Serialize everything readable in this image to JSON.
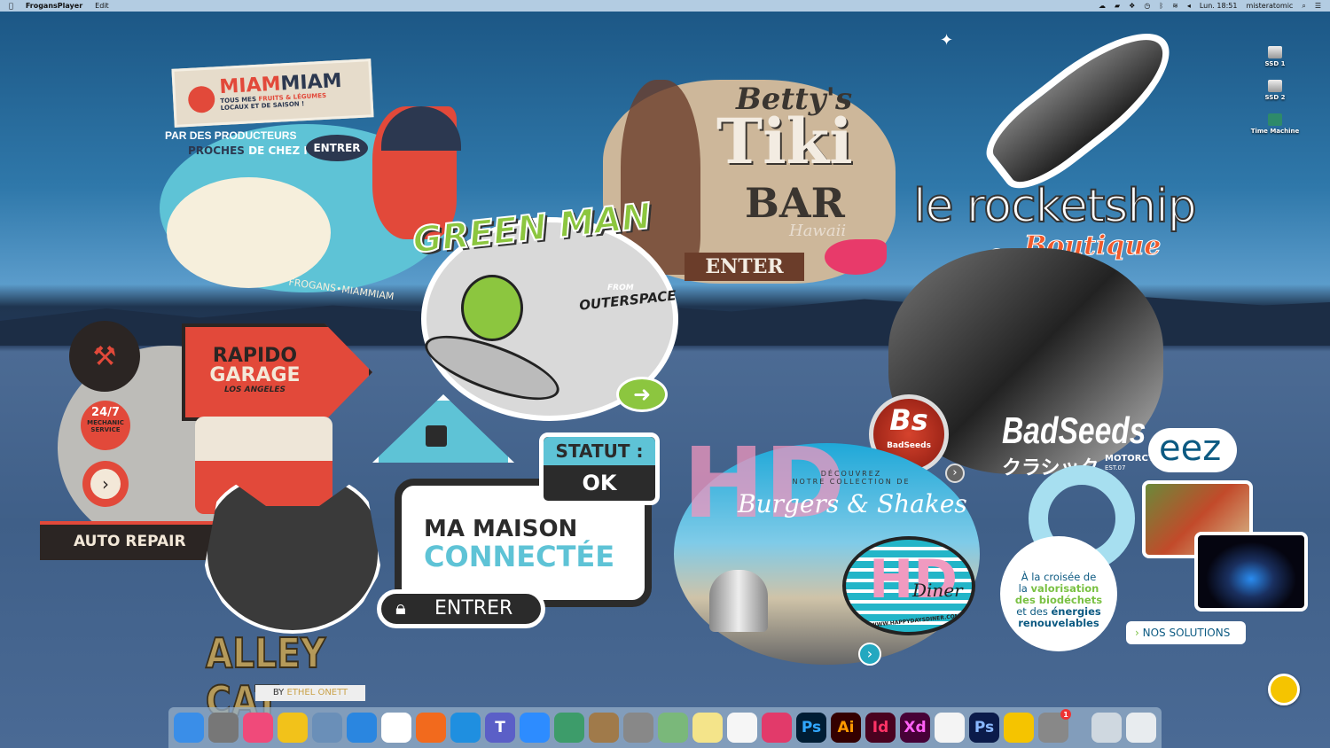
{
  "menubar": {
    "app_name": "FrogansPlayer",
    "menus": [
      "Edit"
    ],
    "clock": "Lun. 18:51",
    "user": "misteratomic",
    "icons": [
      "creative-cloud-icon",
      "notification-icon",
      "dropbox-icon",
      "time-machine-icon",
      "bluetooth-icon",
      "wifi-icon",
      "volume-icon",
      "search-icon",
      "list-icon"
    ]
  },
  "desktop": {
    "icons": [
      {
        "label": "SSD 1"
      },
      {
        "label": "SSD 2"
      },
      {
        "label": "Time Machine"
      }
    ]
  },
  "stickers": {
    "miammiam": {
      "brand_a": "MIAM",
      "brand_b": "MIAM",
      "tagline_1": "TOUS MES ",
      "tagline_hl": "FRUITS & LÉGUMES",
      "tagline_2": "LOCAUX ET DE SAISON !",
      "bubble_1": "PAR DES PRODUCTEURS",
      "bubble_2a": "PROCHES",
      "bubble_2b": " DE CHEZ MOI",
      "enter": "ENTRER",
      "footer": "FROGANS•MIAMMIAM"
    },
    "garage": {
      "title_1": "RAPIDO",
      "title_2": "GARAGE",
      "city": "LOS ANGELES",
      "badge_1": "24/7",
      "badge_2": "MECHANIC",
      "badge_3": "SERVICE",
      "footer": "AUTO REPAIR"
    },
    "greenman": {
      "title": "GREEN MAN",
      "from": "FROM",
      "place": "OUTERSPACE"
    },
    "tiki": {
      "name": "Betty's",
      "title": "Tiki",
      "bar": "BAR",
      "place": "Hawaii",
      "enter": "ENTER"
    },
    "rocket": {
      "title": "le rocketship",
      "subtitle": "Boutique Café"
    },
    "badseeds": {
      "logo": "Bs",
      "logo_small": "BadSeeds",
      "title": "BadSeeds",
      "jp": "クラシック",
      "sub": "MOTORCYCLES",
      "est": "EST.07"
    },
    "hddiner": {
      "line_1": "DÉCOUVREZ",
      "line_2": "NOTRE COLLECTION DE",
      "script": "Burgers & Shakes",
      "logo": "HD",
      "logo_script": "Diner",
      "url": "WWW.HAPPYDAYSDINER.COM"
    },
    "maison": {
      "status_label": "STATUT :",
      "status": "OK",
      "title_1": "MA MAISON",
      "title_2": "CONNECTÉE",
      "enter": "ENTRER"
    },
    "alleycat": {
      "title": "ALLEY CAT",
      "by": "BY ",
      "author": "ETHEL ONETT"
    },
    "eez": {
      "logo": "eez",
      "text_1": "À la croisée de",
      "text_2a": "la ",
      "text_2b": "valorisation",
      "text_3": "des biodéchets",
      "text_4a": "et des ",
      "text_4b": "énergies",
      "text_5": "renouvelables",
      "button": "NOS SOLUTIONS"
    }
  },
  "dock": {
    "apps": [
      {
        "name": "finder",
        "color": "#3a8ee8"
      },
      {
        "name": "launchpad",
        "color": "#777"
      },
      {
        "name": "music",
        "color": "#f04a7a"
      },
      {
        "name": "cyberduck",
        "color": "#f2c21a"
      },
      {
        "name": "mail",
        "color": "#6a8fb8"
      },
      {
        "name": "safari",
        "color": "#2a86e0"
      },
      {
        "name": "chrome",
        "color": "#fff"
      },
      {
        "name": "firefox",
        "color": "#f26a1d"
      },
      {
        "name": "vscode",
        "color": "#1f8fe0"
      },
      {
        "name": "teams",
        "color": "#5b5fc7",
        "label": "T"
      },
      {
        "name": "zoom",
        "color": "#2d8cff"
      },
      {
        "name": "atom",
        "color": "#3d9c6a"
      },
      {
        "name": "contacts",
        "color": "#a07a4a"
      },
      {
        "name": "calculator",
        "color": "#888"
      },
      {
        "name": "maps",
        "color": "#7ab87a"
      },
      {
        "name": "notes",
        "color": "#f4e48a"
      },
      {
        "name": "reminders",
        "color": "#f6f6f6"
      },
      {
        "name": "creative-cloud",
        "color": "#e23a6a"
      },
      {
        "name": "photoshop",
        "color": "#001d34",
        "label": "Ps",
        "fg": "#31a8ff"
      },
      {
        "name": "illustrator",
        "color": "#330000",
        "label": "Ai",
        "fg": "#ff9a00"
      },
      {
        "name": "indesign",
        "color": "#49021f",
        "label": "Id",
        "fg": "#ff3366"
      },
      {
        "name": "xd",
        "color": "#470137",
        "label": "Xd",
        "fg": "#ff61f6"
      },
      {
        "name": "acrobat",
        "color": "#f4f4f4"
      },
      {
        "name": "photoshop-2",
        "color": "#0b1b4a",
        "label": "Ps",
        "fg": "#8ab8ff"
      },
      {
        "name": "frogans",
        "color": "#f5c400"
      },
      {
        "name": "system-preferences",
        "color": "#888",
        "badge": "1"
      }
    ],
    "extras": [
      {
        "name": "xcode-doc",
        "color": "#cfd8e0"
      },
      {
        "name": "trash",
        "color": "#e8ecef"
      }
    ]
  },
  "colors": {
    "menubar": "#b3cce2",
    "red": "#e2493a",
    "navy": "#2c3850",
    "cyan": "#5ec3d6",
    "green": "#8cc63f",
    "eez_blue": "#0c5a82",
    "eez_green": "#7ac143"
  }
}
